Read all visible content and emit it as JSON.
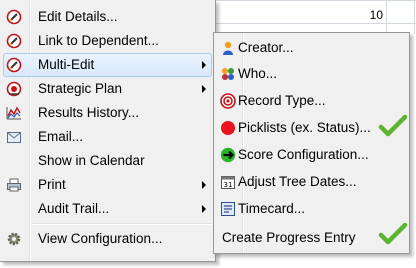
{
  "background": {
    "cell_value": "10"
  },
  "menu": {
    "items": [
      {
        "label": "Edit Details...",
        "icon": "pencil-circle-icon"
      },
      {
        "label": "Link to Dependent...",
        "icon": "pencil-circle-icon"
      },
      {
        "label": "Multi-Edit",
        "icon": "pencil-circle-icon",
        "has_submenu": true,
        "selected": true
      },
      {
        "label": "Strategic Plan",
        "icon": "strategic-plan-icon",
        "has_submenu": true
      },
      {
        "label": "Results History...",
        "icon": "chart-line-icon"
      },
      {
        "label": "Email...",
        "icon": "envelope-icon"
      },
      {
        "label": "Show in Calendar",
        "icon": ""
      },
      {
        "label": "Print",
        "icon": "printer-icon",
        "has_submenu": true
      },
      {
        "label": "Audit Trail...",
        "icon": "",
        "has_submenu": true
      },
      {
        "label": "View Configuration...",
        "icon": "gear-icon"
      }
    ]
  },
  "submenu": {
    "items": [
      {
        "label": "Creator...",
        "icon": "person-icon"
      },
      {
        "label": "Who...",
        "icon": "people-icon"
      },
      {
        "label": "Record Type...",
        "icon": "target-icon"
      },
      {
        "label": "Picklists (ex. Status)...",
        "icon": "red-dot-icon",
        "checked": true
      },
      {
        "label": "Score Configuration...",
        "icon": "green-arrow-icon"
      },
      {
        "label": "Adjust Tree Dates...",
        "icon": "calendar-icon"
      },
      {
        "label": "Timecard...",
        "icon": "timecard-icon"
      },
      {
        "label": "Create Progress Entry",
        "icon": "",
        "checked": true
      }
    ]
  },
  "colors": {
    "selection_bg": "#d8e8fa",
    "selection_border": "#a8cdf1",
    "checkmark": "#5cb531"
  }
}
